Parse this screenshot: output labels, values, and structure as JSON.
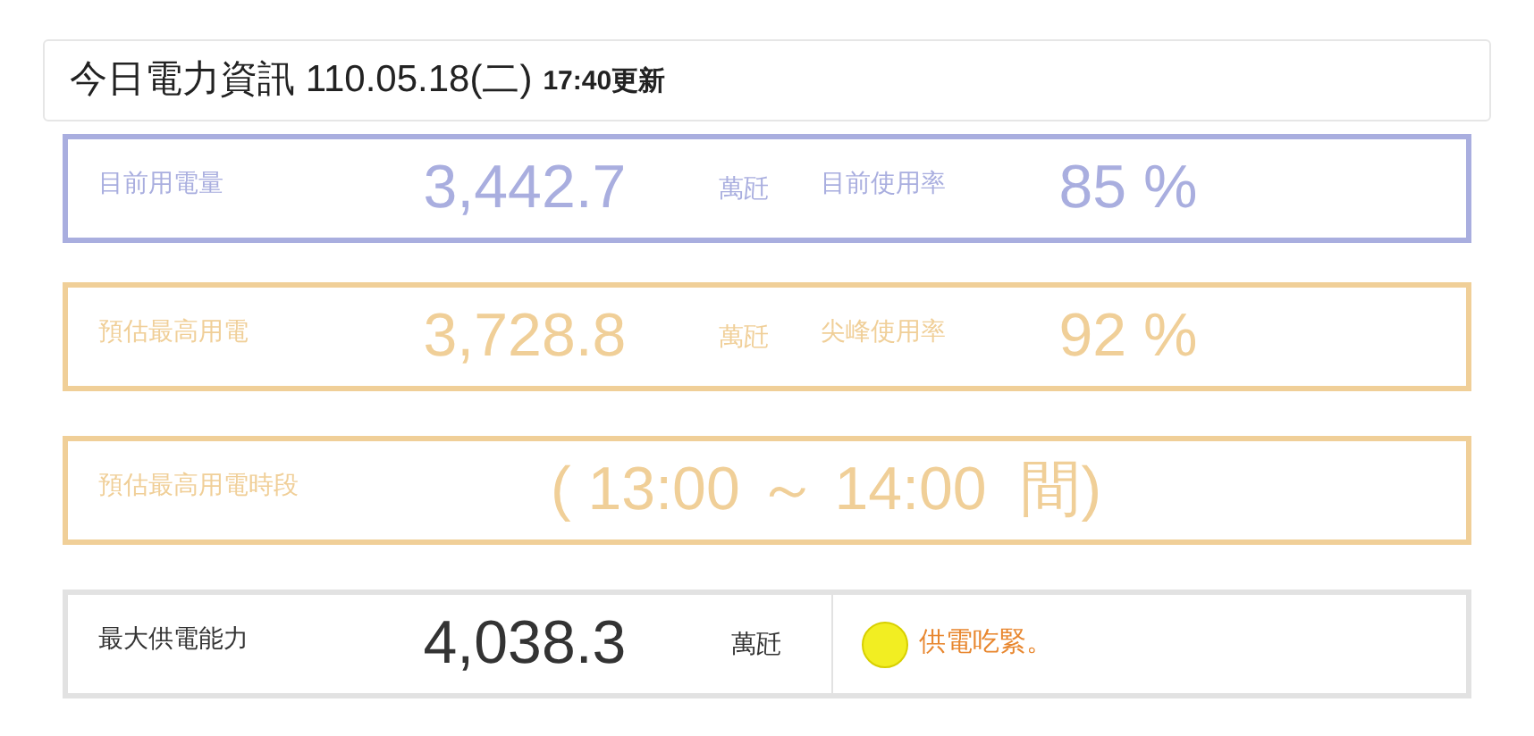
{
  "header": {
    "title": "今日電力資訊 110.05.18(二)",
    "updated": "17:40更新"
  },
  "panels": [
    {
      "kind": "metric",
      "color": "#a9aedf",
      "label": "目前用電量",
      "value": "3,442.7",
      "unit": "萬瓩",
      "label_2": "目前使用率",
      "value_2": "85 %"
    },
    {
      "kind": "metric",
      "color": "#f0cf98",
      "label": "預估最高用電",
      "value": "3,728.8",
      "unit": "萬瓩",
      "label_2": "尖峰使用率",
      "value_2": "92 %"
    },
    {
      "kind": "period",
      "color": "#f0cf98",
      "label": "預估最高用電時段",
      "value": "( 13:00 ～ 14:00  間)"
    },
    {
      "kind": "supply",
      "label": "最大供電能力",
      "value": "4,038.3",
      "unit": "萬瓩",
      "status": {
        "color": "#f2ee22",
        "text": "供電吃緊。"
      }
    }
  ]
}
